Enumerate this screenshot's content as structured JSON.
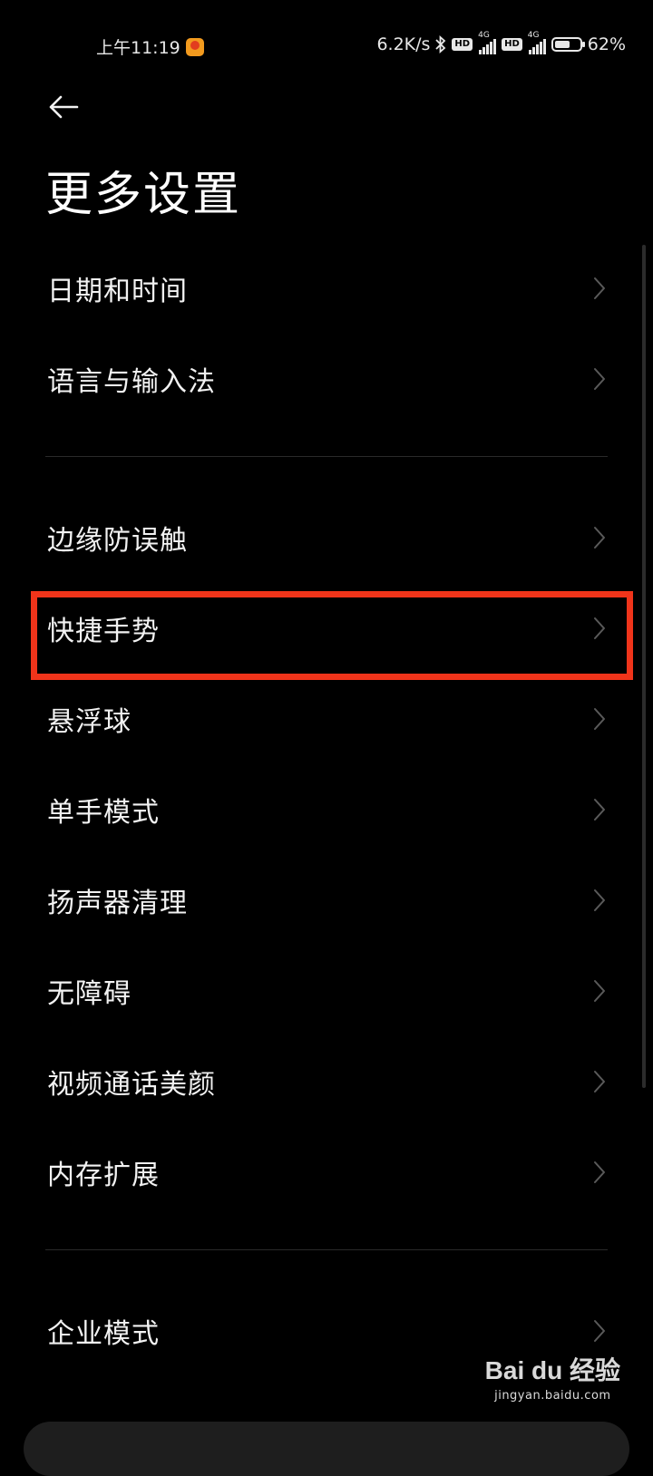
{
  "status_bar": {
    "time": "上午11:19",
    "net_speed": "6.2K/s",
    "hd1": "HD",
    "net1": "4G",
    "hd2": "HD",
    "net2": "4G",
    "battery_percent": "62%",
    "battery_level": 0.62
  },
  "page": {
    "title": "更多设置"
  },
  "items": [
    {
      "label": "日期和时间"
    },
    {
      "label": "语言与输入法"
    },
    {
      "label": "边缘防误触"
    },
    {
      "label": "快捷手势"
    },
    {
      "label": "悬浮球"
    },
    {
      "label": "单手模式"
    },
    {
      "label": "扬声器清理"
    },
    {
      "label": "无障碍"
    },
    {
      "label": "视频通话美颜"
    },
    {
      "label": "内存扩展"
    },
    {
      "label": "企业模式"
    }
  ],
  "watermark": {
    "logo": "Bai du 经验",
    "url": "jingyan.baidu.com"
  },
  "colors": {
    "background": "#000000",
    "highlight": "#f0341a",
    "text": "#f2f2f2",
    "chevron": "#5a5a5a"
  }
}
